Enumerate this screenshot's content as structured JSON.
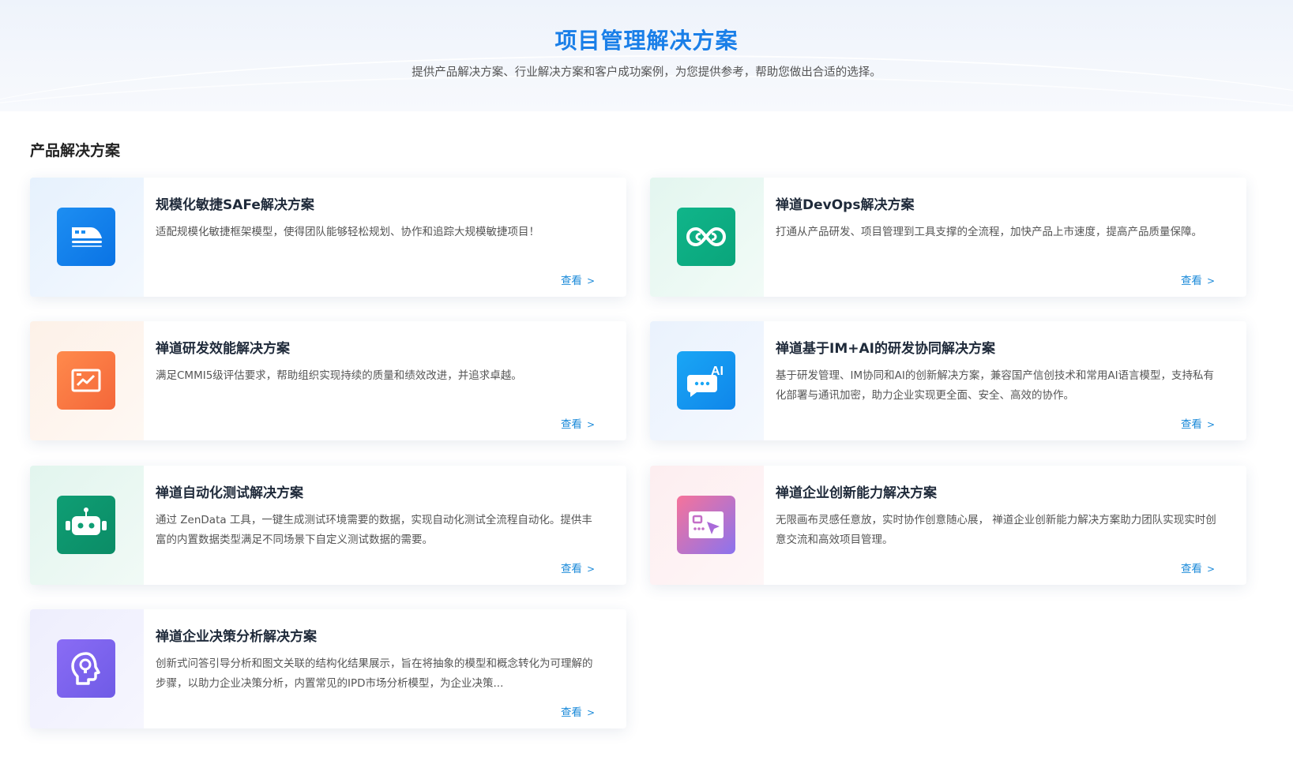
{
  "hero": {
    "title": "项目管理解决方案",
    "subtitle": "提供产品解决方案、行业解决方案和客户成功案例，为您提供参考，帮助您做出合适的选择。"
  },
  "section": {
    "title": "产品解决方案"
  },
  "more_label": "查看",
  "more_arrow": ">",
  "icon_text": {
    "ai": "AI"
  },
  "colors": {
    "accent": "#1a7fe8",
    "link": "#1b8ad9"
  },
  "cards": [
    {
      "title": "规模化敏捷SAFe解决方案",
      "desc": "适配规模化敏捷框架模型，使得团队能够轻松规划、协作和追踪大规模敏捷项目！",
      "icon": "train-icon"
    },
    {
      "title": "禅道DevOps解决方案",
      "desc": "打通从产品研发、项目管理到工具支撑的全流程，加快产品上市速度，提高产品质量保障。",
      "icon": "infinity-icon"
    },
    {
      "title": "禅道研发效能解决方案",
      "desc": "满足CMMI5级评估要求，帮助组织实现持续的质量和绩效改进，并追求卓越。",
      "icon": "chart-icon"
    },
    {
      "title": "禅道基于IM+AI的研发协同解决方案",
      "desc": "基于研发管理、IM协同和AI的创新解决方案，兼容国产信创技术和常用AI语言模型，支持私有化部署与通讯加密，助力企业实现更全面、安全、高效的协作。",
      "icon": "ai-chat-icon"
    },
    {
      "title": "禅道自动化测试解决方案",
      "desc": "通过 ZenData 工具，一键生成测试环境需要的数据，实现自动化测试全流程自动化。提供丰富的内置数据类型满足不同场景下自定义测试数据的需要。",
      "icon": "robot-icon"
    },
    {
      "title": "禅道企业创新能力解决方案",
      "desc": "无限画布灵感任意放，实时协作创意随心展， 禅道企业创新能力解决方案助力团队实现实时创意交流和高效项目管理。",
      "icon": "canvas-icon"
    },
    {
      "title": "禅道企业决策分析解决方案",
      "desc": "创新式问答引导分析和图文关联的结构化结果展示，旨在将抽象的模型和概念转化为可理解的步骤，以助力企业决策分析，内置常见的IPD市场分析模型，为企业决策...",
      "icon": "head-bulb-icon"
    }
  ]
}
